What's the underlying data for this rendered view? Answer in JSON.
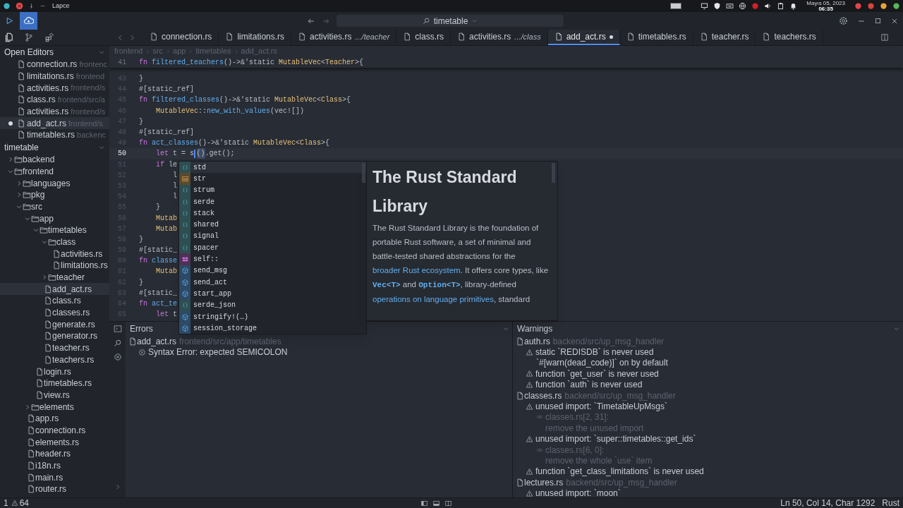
{
  "os_bar": {
    "app_name": "Lapce",
    "date": "Mayıs 05, 2023",
    "time": "06:35"
  },
  "title_bar": {
    "search": "timetable"
  },
  "tabs": [
    {
      "name": "connection.rs",
      "selected": false,
      "modified": false
    },
    {
      "name": "limitations.rs",
      "selected": false,
      "modified": false
    },
    {
      "name": "activities.rs",
      "hint": ".../teacher",
      "selected": false,
      "modified": false
    },
    {
      "name": "class.rs",
      "selected": false,
      "modified": false
    },
    {
      "name": "activities.rs",
      "hint": ".../class",
      "selected": false,
      "modified": false
    },
    {
      "name": "add_act.rs",
      "selected": true,
      "modified": true
    },
    {
      "name": "timetables.rs",
      "selected": false,
      "modified": false
    },
    {
      "name": "teacher.rs",
      "selected": false,
      "modified": false
    },
    {
      "name": "teachers.rs",
      "selected": false,
      "modified": false
    }
  ],
  "sidebar": {
    "open_editors": {
      "title": "Open Editors",
      "items": [
        {
          "name": "connection.rs",
          "path": "frontenc",
          "selected": false,
          "modified": false
        },
        {
          "name": "limitations.rs",
          "path": "frontend",
          "selected": false,
          "modified": false
        },
        {
          "name": "activities.rs",
          "path": "frontend/s",
          "selected": false,
          "modified": false
        },
        {
          "name": "class.rs",
          "path": "frontend/src/a",
          "selected": false,
          "modified": false
        },
        {
          "name": "activities.rs",
          "path": "frontend/s",
          "selected": false,
          "modified": false
        },
        {
          "name": "add_act.rs",
          "path": "frontend/s",
          "selected": true,
          "modified": true
        },
        {
          "name": "timetables.rs",
          "path": "backenc",
          "selected": false,
          "modified": false
        }
      ]
    },
    "explorer": {
      "title": "timetable",
      "tree": [
        {
          "name": "backend",
          "kind": "folder",
          "expanded": false,
          "selected": false
        },
        {
          "name": "frontend",
          "kind": "folder",
          "expanded": true,
          "selected": false,
          "children": [
            {
              "name": "languages",
              "kind": "folder",
              "expanded": false,
              "selected": false
            },
            {
              "name": "pkg",
              "kind": "folder",
              "expanded": false,
              "selected": false
            },
            {
              "name": "src",
              "kind": "folder",
              "expanded": true,
              "selected": false,
              "children": [
                {
                  "name": "app",
                  "kind": "folder",
                  "expanded": true,
                  "selected": false,
                  "children": [
                    {
                      "name": "timetables",
                      "kind": "folder",
                      "expanded": true,
                      "selected": false,
                      "children": [
                        {
                          "name": "class",
                          "kind": "folder",
                          "expanded": true,
                          "selected": false,
                          "children": [
                            {
                              "name": "activities.rs",
                              "kind": "file",
                              "selected": false
                            },
                            {
                              "name": "limitations.rs",
                              "kind": "file",
                              "selected": false
                            }
                          ]
                        },
                        {
                          "name": "teacher",
                          "kind": "folder",
                          "expanded": false,
                          "selected": false
                        },
                        {
                          "name": "add_act.rs",
                          "kind": "file",
                          "selected": true
                        },
                        {
                          "name": "class.rs",
                          "kind": "file",
                          "selected": false
                        },
                        {
                          "name": "classes.rs",
                          "kind": "file",
                          "selected": false
                        },
                        {
                          "name": "generate.rs",
                          "kind": "file",
                          "selected": false
                        },
                        {
                          "name": "generator.rs",
                          "kind": "file",
                          "selected": false
                        },
                        {
                          "name": "teacher.rs",
                          "kind": "file",
                          "selected": false
                        },
                        {
                          "name": "teachers.rs",
                          "kind": "file",
                          "selected": false
                        }
                      ]
                    },
                    {
                      "name": "login.rs",
                      "kind": "file",
                      "selected": false
                    },
                    {
                      "name": "timetables.rs",
                      "kind": "file",
                      "selected": false
                    },
                    {
                      "name": "view.rs",
                      "kind": "file",
                      "selected": false
                    }
                  ]
                },
                {
                  "name": "elements",
                  "kind": "folder",
                  "expanded": false,
                  "selected": false
                },
                {
                  "name": "app.rs",
                  "kind": "file",
                  "selected": false
                },
                {
                  "name": "connection.rs",
                  "kind": "file",
                  "selected": false
                },
                {
                  "name": "elements.rs",
                  "kind": "file",
                  "selected": false
                },
                {
                  "name": "header.rs",
                  "kind": "file",
                  "selected": false
                },
                {
                  "name": "i18n.rs",
                  "kind": "file",
                  "selected": false
                },
                {
                  "name": "main.rs",
                  "kind": "file",
                  "selected": false
                },
                {
                  "name": "router.rs",
                  "kind": "file",
                  "selected": false
                }
              ]
            }
          ]
        }
      ]
    }
  },
  "editor": {
    "breadcrumb": [
      "frontend",
      "src",
      "app",
      "timetables",
      "add_act.rs"
    ],
    "lines": [
      {
        "number": "41",
        "sticky": true,
        "current": false,
        "segments": [
          {
            "t": "fn ",
            "kind": "kw"
          },
          {
            "t": "filtered_teachers",
            "kind": "fn"
          },
          {
            "t": "()->&'static ",
            "kind": "plain"
          },
          {
            "t": "MutableVec",
            "kind": "ty"
          },
          {
            "t": "<",
            "kind": "plain"
          },
          {
            "t": "Teacher",
            "kind": "ty"
          },
          {
            "t": ">{",
            "kind": "plain"
          }
        ]
      },
      {
        "number": "43",
        "sticky": false,
        "current": false,
        "segments": [
          {
            "t": "}",
            "kind": "plain"
          }
        ]
      },
      {
        "number": "44",
        "sticky": false,
        "current": false,
        "segments": [
          {
            "t": "#[static_ref]",
            "kind": "attr"
          }
        ]
      },
      {
        "number": "45",
        "sticky": false,
        "current": false,
        "segments": [
          {
            "t": "fn ",
            "kind": "kw"
          },
          {
            "t": "filtered_classes",
            "kind": "fn"
          },
          {
            "t": "()->&'static ",
            "kind": "plain"
          },
          {
            "t": "MutableVec",
            "kind": "ty"
          },
          {
            "t": "<",
            "kind": "plain"
          },
          {
            "t": "Class",
            "kind": "ty"
          },
          {
            "t": ">{",
            "kind": "plain"
          }
        ]
      },
      {
        "number": "46",
        "sticky": false,
        "current": false,
        "segments": [
          {
            "t": "    MutableVec",
            "kind": "ty"
          },
          {
            "t": "::",
            "kind": "plain"
          },
          {
            "t": "new_with_values",
            "kind": "fn"
          },
          {
            "t": "(vec![])",
            "kind": "plain"
          }
        ]
      },
      {
        "number": "47",
        "sticky": false,
        "current": false,
        "segments": [
          {
            "t": "}",
            "kind": "plain"
          }
        ]
      },
      {
        "number": "48",
        "sticky": false,
        "current": false,
        "segments": [
          {
            "t": "#[static_ref]",
            "kind": "attr"
          }
        ]
      },
      {
        "number": "49",
        "sticky": false,
        "current": false,
        "segments": [
          {
            "t": "fn ",
            "kind": "kw"
          },
          {
            "t": "act_classes",
            "kind": "fn"
          },
          {
            "t": "()->&'static ",
            "kind": "plain"
          },
          {
            "t": "MutableVec",
            "kind": "ty"
          },
          {
            "t": "<",
            "kind": "plain"
          },
          {
            "t": "Class",
            "kind": "ty"
          },
          {
            "t": ">{",
            "kind": "plain"
          }
        ]
      },
      {
        "number": "50",
        "sticky": false,
        "current": true,
        "segments": [
          {
            "t": "    let ",
            "kind": "kw"
          },
          {
            "t": "t = s",
            "kind": "plain"
          },
          {
            "kind": "cursor"
          },
          {
            "t": "()",
            "kind": "match"
          },
          {
            "t": ".get();",
            "kind": "plain"
          }
        ]
      },
      {
        "number": "51",
        "sticky": false,
        "current": false,
        "segments": [
          {
            "t": "    if ",
            "kind": "kw"
          },
          {
            "t": "le",
            "kind": "plain"
          }
        ]
      },
      {
        "number": "52",
        "sticky": false,
        "current": false,
        "segments": [
          {
            "t": "        l",
            "kind": "plain"
          }
        ]
      },
      {
        "number": "53",
        "sticky": false,
        "current": false,
        "segments": [
          {
            "t": "        l",
            "kind": "plain"
          }
        ]
      },
      {
        "number": "54",
        "sticky": false,
        "current": false,
        "segments": [
          {
            "t": "        l",
            "kind": "plain"
          }
        ]
      },
      {
        "number": "55",
        "sticky": false,
        "current": false,
        "segments": [
          {
            "t": "    }",
            "kind": "plain"
          }
        ]
      },
      {
        "number": "56",
        "sticky": false,
        "current": false,
        "segments": [
          {
            "t": "    Mutab",
            "kind": "ty"
          }
        ]
      },
      {
        "number": "57",
        "sticky": false,
        "current": false,
        "segments": [
          {
            "t": "    Mutab",
            "kind": "ty"
          }
        ]
      },
      {
        "number": "58",
        "sticky": false,
        "current": false,
        "segments": [
          {
            "t": "}",
            "kind": "plain"
          }
        ]
      },
      {
        "number": "59",
        "sticky": false,
        "current": false,
        "segments": [
          {
            "t": "#[static_",
            "kind": "attr"
          }
        ]
      },
      {
        "number": "60",
        "sticky": false,
        "current": false,
        "segments": [
          {
            "t": "fn ",
            "kind": "kw"
          },
          {
            "t": "classe",
            "kind": "fn"
          }
        ]
      },
      {
        "number": "61",
        "sticky": false,
        "current": false,
        "segments": [
          {
            "t": "    Mutab",
            "kind": "ty"
          }
        ]
      },
      {
        "number": "62",
        "sticky": false,
        "current": false,
        "segments": [
          {
            "t": "}",
            "kind": "plain"
          }
        ]
      },
      {
        "number": "63",
        "sticky": false,
        "current": false,
        "segments": [
          {
            "t": "#[static_",
            "kind": "attr"
          }
        ]
      },
      {
        "number": "64",
        "sticky": false,
        "current": false,
        "segments": [
          {
            "t": "fn ",
            "kind": "kw"
          },
          {
            "t": "act_te",
            "kind": "fn"
          }
        ]
      },
      {
        "number": "65",
        "sticky": false,
        "current": false,
        "segments": [
          {
            "t": "    let ",
            "kind": "kw"
          },
          {
            "t": "t",
            "kind": "plain"
          }
        ]
      }
    ]
  },
  "completion": {
    "items": [
      {
        "label": "std",
        "kind": "module",
        "selected": true
      },
      {
        "label": "str",
        "kind": "struct",
        "selected": false
      },
      {
        "label": "strum",
        "kind": "module",
        "selected": false
      },
      {
        "label": "serde",
        "kind": "module",
        "selected": false
      },
      {
        "label": "stack",
        "kind": "module",
        "selected": false
      },
      {
        "label": "shared",
        "kind": "module",
        "selected": false
      },
      {
        "label": "signal",
        "kind": "module",
        "selected": false
      },
      {
        "label": "spacer",
        "kind": "module",
        "selected": false
      },
      {
        "label": "self::",
        "kind": "keyword",
        "selected": false
      },
      {
        "label": "send_msg",
        "kind": "function",
        "selected": false
      },
      {
        "label": "send_act",
        "kind": "function",
        "selected": false
      },
      {
        "label": "start_app",
        "kind": "function",
        "selected": false
      },
      {
        "label": "serde_json",
        "kind": "module",
        "selected": false
      },
      {
        "label": "stringify!(…)",
        "kind": "function",
        "selected": false
      },
      {
        "label": "session_storage",
        "kind": "function",
        "selected": false
      }
    ]
  },
  "docs": {
    "title": "The Rust Standard Library",
    "body": [
      {
        "t": "The Rust Standard Library is the foundation of portable Rust software, a set of minimal and battle-tested shared abstractions for the ",
        "kind": "text"
      },
      {
        "t": "broader Rust ecosystem",
        "kind": "link"
      },
      {
        "t": ". It offers core types, like ",
        "kind": "text"
      },
      {
        "t": "Vec<T>",
        "kind": "code"
      },
      {
        "t": " and ",
        "kind": "text"
      },
      {
        "t": "Option<T>",
        "kind": "code"
      },
      {
        "t": ", library-defined ",
        "kind": "text"
      },
      {
        "t": "operations on language primitives",
        "kind": "link"
      },
      {
        "t": ", standard",
        "kind": "text"
      }
    ]
  },
  "panels": [
    {
      "title": "Errors",
      "kind": "error",
      "files": [
        {
          "name": "add_act.rs",
          "path": "frontend/src/app/timetables",
          "items": [
            {
              "message": "Syntax Error: expected SEMICOLON"
            }
          ]
        }
      ]
    },
    {
      "title": "Warnings",
      "kind": "warning",
      "files": [
        {
          "name": "auth.rs",
          "path": "backend/src/up_msg_handler",
          "items": [
            {
              "message": "static `REDISDB` is never used",
              "notes": [
                "`#[warn(dead_code)]` on by default"
              ]
            },
            {
              "message": "function `get_user` is never used"
            },
            {
              "message": "function `auth` is never used"
            }
          ]
        },
        {
          "name": "classes.rs",
          "path": "backend/src/up_msg_handler",
          "items": [
            {
              "message": "unused import: `TimetableUpMsgs`",
              "related": [
                {
                  "location": "classes.rs[2, 31]:",
                  "message": "remove the unused import"
                }
              ]
            },
            {
              "message": "unused import: `super::timetables::get_ids`",
              "related": [
                {
                  "location": "classes.rs[6, 0]:",
                  "message": "remove the whole `use` item"
                }
              ]
            },
            {
              "message": "function `get_class_limitations` is never used"
            }
          ]
        },
        {
          "name": "lectures.rs",
          "path": "backend/src/up_msg_handler",
          "items": [
            {
              "message": "unused import: `moon`"
            }
          ]
        }
      ]
    }
  ],
  "status_bar": {
    "errors": "1",
    "warnings": "64",
    "position": "Ln 50, Col 14, Char 1292",
    "language": "Rust"
  }
}
